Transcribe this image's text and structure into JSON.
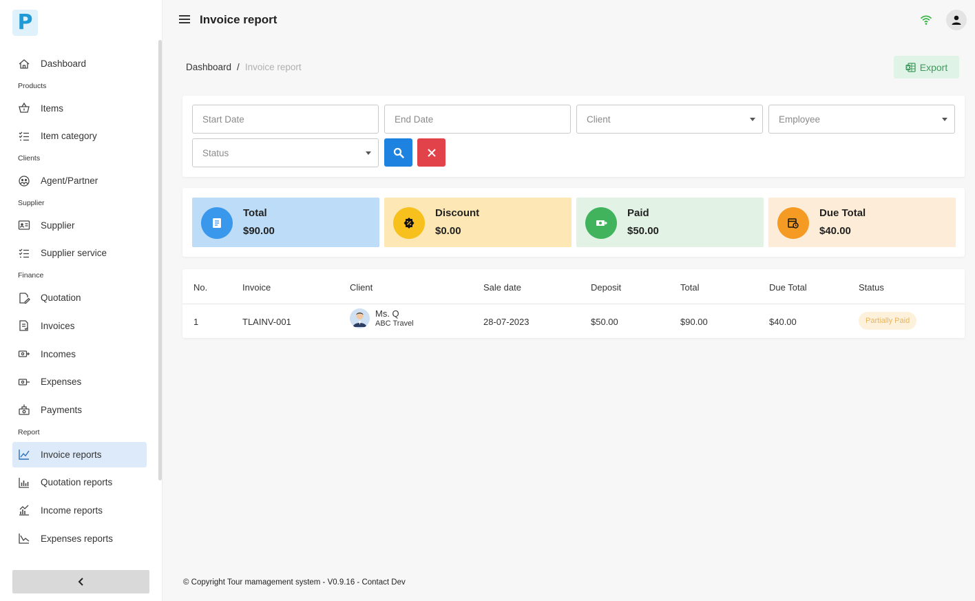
{
  "app": {
    "logo_letter": "P",
    "page_title": "Invoice report"
  },
  "sidebar": {
    "items": [
      {
        "type": "item",
        "label": "Dashboard",
        "icon": "home-icon"
      },
      {
        "type": "section",
        "label": "Products"
      },
      {
        "type": "item",
        "label": "Items",
        "icon": "basket-icon"
      },
      {
        "type": "item",
        "label": "Item category",
        "icon": "list-check-icon"
      },
      {
        "type": "section",
        "label": "Clients"
      },
      {
        "type": "item",
        "label": "Agent/Partner",
        "icon": "partner-icon"
      },
      {
        "type": "section",
        "label": "Supplier"
      },
      {
        "type": "item",
        "label": "Supplier",
        "icon": "id-card-icon"
      },
      {
        "type": "item",
        "label": "Supplier service",
        "icon": "list-check-icon"
      },
      {
        "type": "section",
        "label": "Finance"
      },
      {
        "type": "item",
        "label": "Quotation",
        "icon": "document-edit-icon"
      },
      {
        "type": "item",
        "label": "Invoices",
        "icon": "invoice-icon"
      },
      {
        "type": "item",
        "label": "Incomes",
        "icon": "money-in-icon"
      },
      {
        "type": "item",
        "label": "Expenses",
        "icon": "money-out-icon"
      },
      {
        "type": "item",
        "label": "Payments",
        "icon": "payments-icon"
      },
      {
        "type": "section",
        "label": "Report"
      },
      {
        "type": "item",
        "label": "Invoice reports",
        "icon": "line-chart-icon",
        "active": true
      },
      {
        "type": "item",
        "label": "Quotation reports",
        "icon": "bar-chart-icon"
      },
      {
        "type": "item",
        "label": "Income reports",
        "icon": "income-chart-icon"
      },
      {
        "type": "item",
        "label": "Expenses reports",
        "icon": "expense-chart-icon"
      }
    ]
  },
  "breadcrumb": {
    "root": "Dashboard",
    "separator": "/",
    "current": "Invoice report"
  },
  "export": {
    "label": "Export"
  },
  "filters": {
    "start_date": "Start Date",
    "end_date": "End Date",
    "client": "Client",
    "employee": "Employee",
    "status": "Status"
  },
  "summary": [
    {
      "label": "Total",
      "value": "$90.00",
      "bg": "#bcdcf7",
      "circle": "#3a98ec"
    },
    {
      "label": "Discount",
      "value": "$0.00",
      "bg": "#fde8b5",
      "circle": "#f7c01c"
    },
    {
      "label": "Paid",
      "value": "$50.00",
      "bg": "#e2f3e6",
      "circle": "#41b35d"
    },
    {
      "label": "Due Total",
      "value": "$40.00",
      "bg": "#fdecd7",
      "circle": "#f59a22"
    }
  ],
  "table": {
    "headers": [
      "No.",
      "Invoice",
      "Client",
      "Sale date",
      "Deposit",
      "Total",
      "Due Total",
      "Status"
    ],
    "rows": [
      {
        "no": "1",
        "invoice": "TLAINV-001",
        "client_name": "Ms. Q",
        "client_org": "ABC Travel",
        "sale_date": "28-07-2023",
        "deposit": "$50.00",
        "total": "$90.00",
        "due_total": "$40.00",
        "status": "Partially Paid"
      }
    ]
  },
  "footer": {
    "text": "© Copyright Tour mamagement system - V0.9.16 - Contact Dev"
  }
}
